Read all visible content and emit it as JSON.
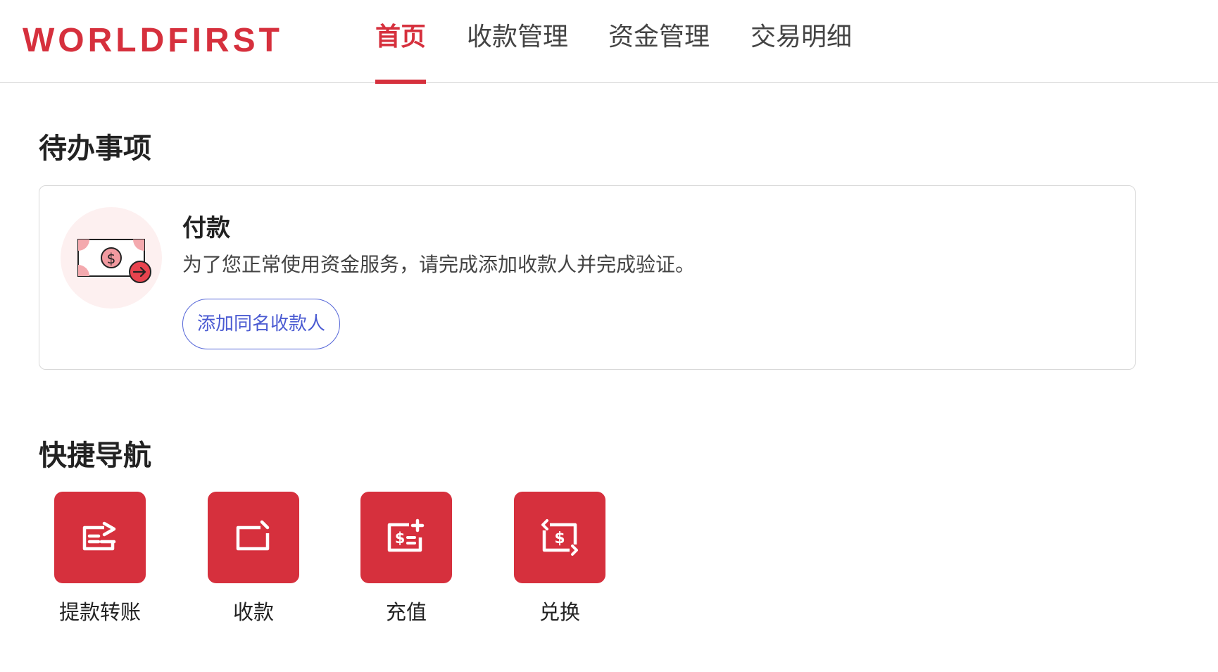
{
  "header": {
    "logo": "WORLDFIRST",
    "nav": [
      {
        "label": "首页",
        "active": true
      },
      {
        "label": "收款管理",
        "active": false
      },
      {
        "label": "资金管理",
        "active": false
      },
      {
        "label": "交易明细",
        "active": false
      }
    ]
  },
  "todo": {
    "section_title": "待办事项",
    "card": {
      "icon": "payment-money-icon",
      "title": "付款",
      "description": "为了您正常使用资金服务，请完成添加收款人并完成验证。",
      "button_label": "添加同名收款人"
    }
  },
  "quick_nav": {
    "section_title": "快捷导航",
    "items": [
      {
        "label": "提款转账",
        "icon": "withdraw-transfer-icon"
      },
      {
        "label": "收款",
        "icon": "receive-icon"
      },
      {
        "label": "充值",
        "icon": "top-up-icon"
      },
      {
        "label": "兑换",
        "icon": "exchange-icon"
      }
    ]
  },
  "colors": {
    "brand": "#d6303d",
    "button_outline": "#5566d8",
    "icon_background": "#fdf0f0"
  }
}
